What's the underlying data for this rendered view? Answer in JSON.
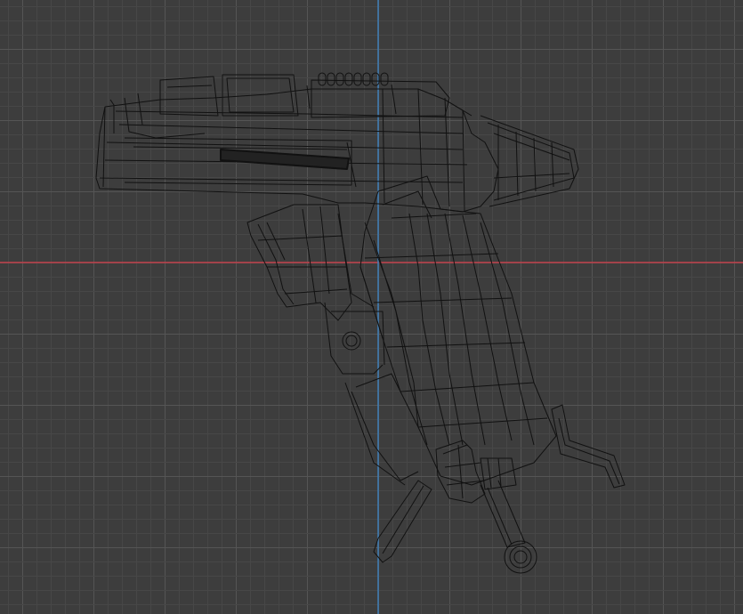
{
  "viewport": {
    "view": "orthographic-side",
    "shading": "wireframe",
    "grid_visible": true,
    "colors": {
      "background": "#3d3d3d",
      "grid_minor": "#474747",
      "grid_major": "#555555",
      "x_axis": "#c2404b",
      "z_axis": "#3f7fb8",
      "wire": "#111111"
    }
  },
  "scene": {
    "object_type": "pistol-model",
    "parts": [
      "slide",
      "barrel-nozzle",
      "frame",
      "trigger-guard",
      "trigger-pin",
      "grip",
      "bipod-leg-left",
      "bipod-leg-right",
      "leg-hinge",
      "pull-ring"
    ]
  }
}
